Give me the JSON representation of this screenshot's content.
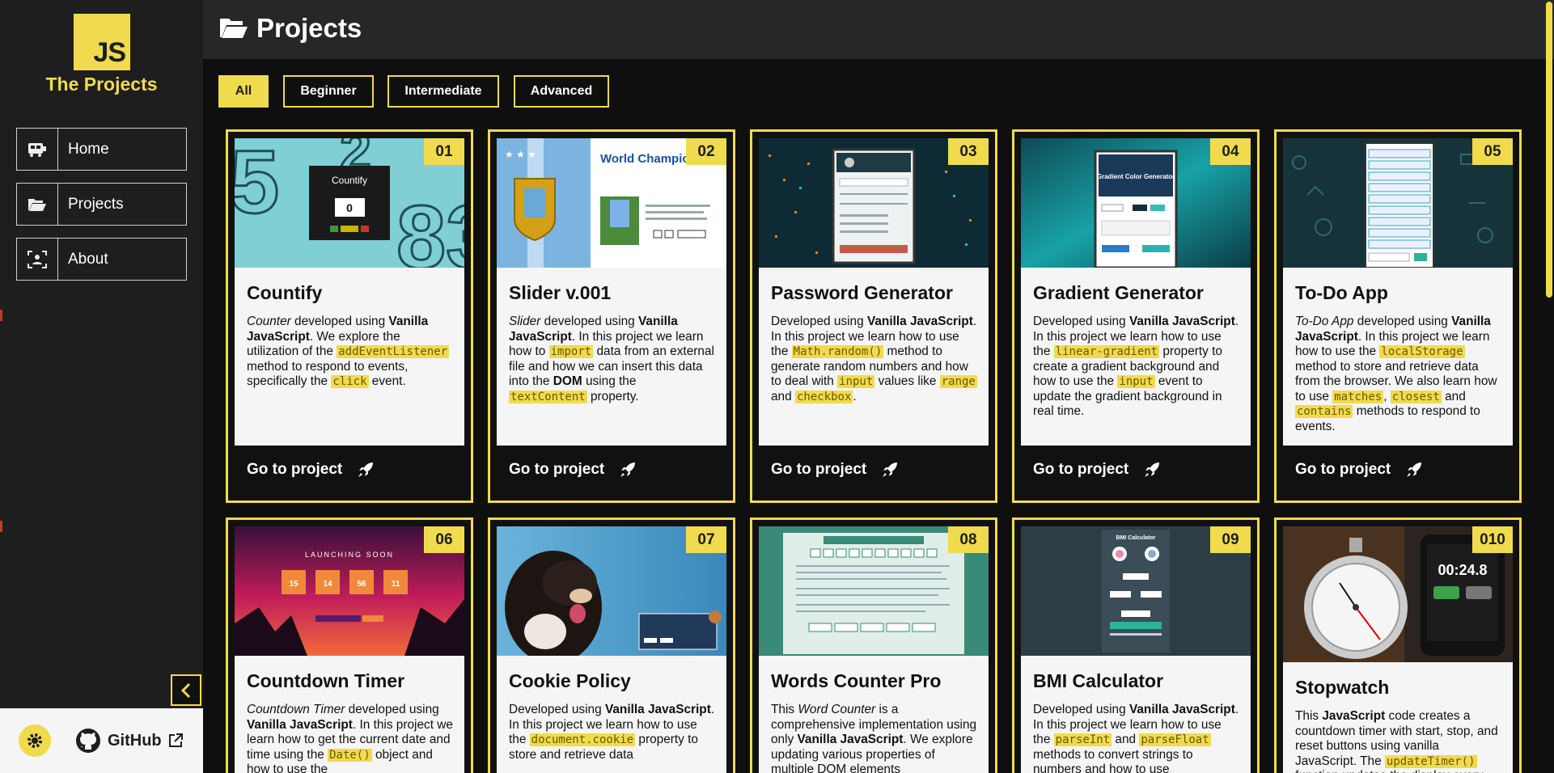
{
  "brand": {
    "logo": "JS",
    "title": "The Projects"
  },
  "nav": [
    {
      "label": "Home",
      "icon": "bus-icon"
    },
    {
      "label": "Projects",
      "icon": "folder-open-icon"
    },
    {
      "label": "About",
      "icon": "user-scan-icon"
    }
  ],
  "footer": {
    "github_label": "GitHub"
  },
  "header": {
    "title": "Projects"
  },
  "filters": [
    {
      "label": "All",
      "active": true
    },
    {
      "label": "Beginner",
      "active": false
    },
    {
      "label": "Intermediate",
      "active": false
    },
    {
      "label": "Advanced",
      "active": false
    }
  ],
  "card_cta": "Go to project",
  "cards": [
    {
      "num": "01",
      "title": "Countify",
      "thumb_text": "Countify",
      "thumb_value": "0"
    },
    {
      "num": "02",
      "title": "Slider v.001",
      "thumb_text": "World Champion"
    },
    {
      "num": "03",
      "title": "Password Generator"
    },
    {
      "num": "04",
      "title": "Gradient Generator",
      "thumb_text": "Gradient Color Generator"
    },
    {
      "num": "05",
      "title": "To-Do App"
    },
    {
      "num": "06",
      "title": "Countdown Timer",
      "thumb_text": "LAUNCHING SOON",
      "thumb_digits": [
        "15",
        "14",
        "56",
        "11"
      ]
    },
    {
      "num": "07",
      "title": "Cookie Policy"
    },
    {
      "num": "08",
      "title": "Words Counter Pro"
    },
    {
      "num": "09",
      "title": "BMI Calculator",
      "thumb_text": "BMI Calculator"
    },
    {
      "num": "010",
      "title": "Stopwatch",
      "thumb_text": "00:24.8"
    }
  ],
  "colors": {
    "accent": "#f0db4f",
    "sidebar": "#1e1e1e",
    "header": "#272727",
    "page": "#0f0f0f"
  }
}
